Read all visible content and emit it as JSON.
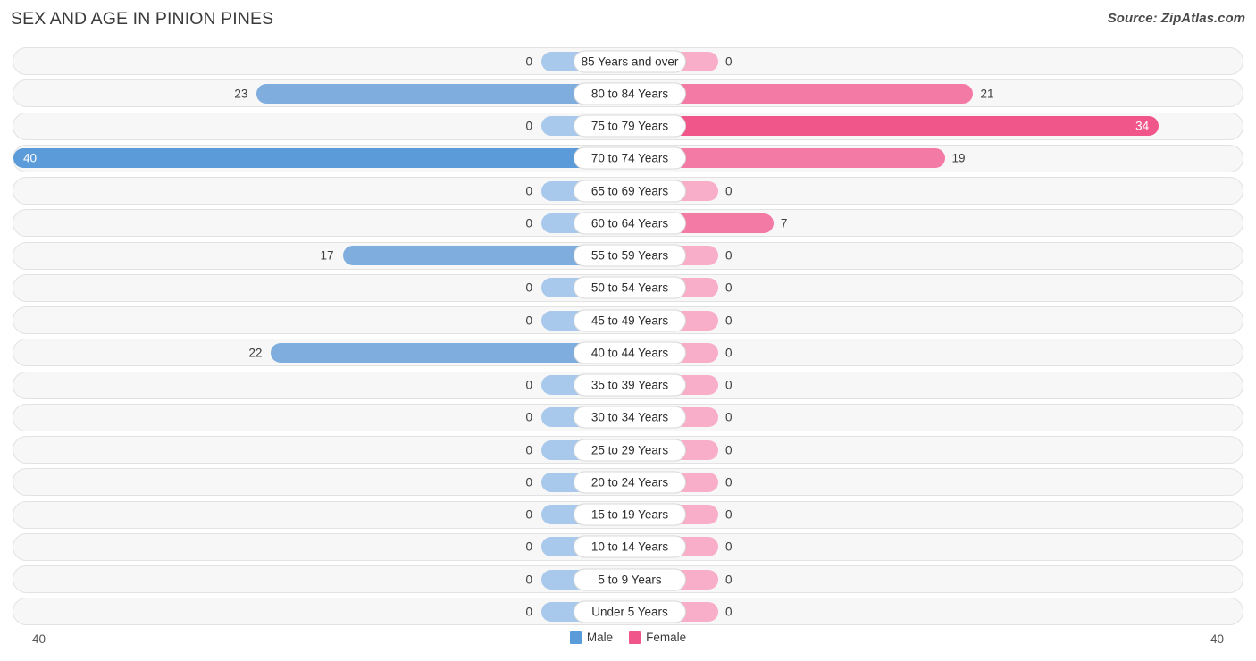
{
  "header": {
    "title": "SEX AND AGE IN PINION PINES",
    "source": "Source: ZipAtlas.com"
  },
  "legend": {
    "male_label": "Male",
    "female_label": "Female",
    "male_color": "#5b9bd9",
    "female_color": "#f05689"
  },
  "axis": {
    "left_label": "40",
    "right_label": "40",
    "max": 40
  },
  "chart_data": {
    "type": "bar",
    "subtype": "population-pyramid",
    "title": "SEX AND AGE IN PINION PINES",
    "xlabel": "",
    "ylabel": "",
    "grid": false,
    "legend_position": "bottom-center",
    "axis_max": 40,
    "xlim": [
      40,
      40
    ],
    "categories": [
      "85 Years and over",
      "80 to 84 Years",
      "75 to 79 Years",
      "70 to 74 Years",
      "65 to 69 Years",
      "60 to 64 Years",
      "55 to 59 Years",
      "50 to 54 Years",
      "45 to 49 Years",
      "40 to 44 Years",
      "35 to 39 Years",
      "30 to 34 Years",
      "25 to 29 Years",
      "20 to 24 Years",
      "15 to 19 Years",
      "10 to 14 Years",
      "5 to 9 Years",
      "Under 5 Years"
    ],
    "series": [
      {
        "name": "Male",
        "color": "#5b9bd9",
        "values": [
          0,
          23,
          0,
          40,
          0,
          0,
          17,
          0,
          0,
          22,
          0,
          0,
          0,
          0,
          0,
          0,
          0,
          0
        ]
      },
      {
        "name": "Female",
        "color": "#f05689",
        "values": [
          0,
          21,
          34,
          19,
          0,
          7,
          0,
          0,
          0,
          0,
          0,
          0,
          0,
          0,
          0,
          0,
          0,
          0
        ]
      }
    ]
  },
  "rows": [
    {
      "label": "85 Years and over",
      "male": 0,
      "male_text": "0",
      "female": 0,
      "female_text": "0"
    },
    {
      "label": "80 to 84 Years",
      "male": 23,
      "male_text": "23",
      "female": 21,
      "female_text": "21"
    },
    {
      "label": "75 to 79 Years",
      "male": 0,
      "male_text": "0",
      "female": 34,
      "female_text": "34"
    },
    {
      "label": "70 to 74 Years",
      "male": 40,
      "male_text": "40",
      "female": 19,
      "female_text": "19"
    },
    {
      "label": "65 to 69 Years",
      "male": 0,
      "male_text": "0",
      "female": 0,
      "female_text": "0"
    },
    {
      "label": "60 to 64 Years",
      "male": 0,
      "male_text": "0",
      "female": 7,
      "female_text": "7"
    },
    {
      "label": "55 to 59 Years",
      "male": 17,
      "male_text": "17",
      "female": 0,
      "female_text": "0"
    },
    {
      "label": "50 to 54 Years",
      "male": 0,
      "male_text": "0",
      "female": 0,
      "female_text": "0"
    },
    {
      "label": "45 to 49 Years",
      "male": 0,
      "male_text": "0",
      "female": 0,
      "female_text": "0"
    },
    {
      "label": "40 to 44 Years",
      "male": 22,
      "male_text": "22",
      "female": 0,
      "female_text": "0"
    },
    {
      "label": "35 to 39 Years",
      "male": 0,
      "male_text": "0",
      "female": 0,
      "female_text": "0"
    },
    {
      "label": "30 to 34 Years",
      "male": 0,
      "male_text": "0",
      "female": 0,
      "female_text": "0"
    },
    {
      "label": "25 to 29 Years",
      "male": 0,
      "male_text": "0",
      "female": 0,
      "female_text": "0"
    },
    {
      "label": "20 to 24 Years",
      "male": 0,
      "male_text": "0",
      "female": 0,
      "female_text": "0"
    },
    {
      "label": "15 to 19 Years",
      "male": 0,
      "male_text": "0",
      "female": 0,
      "female_text": "0"
    },
    {
      "label": "10 to 14 Years",
      "male": 0,
      "male_text": "0",
      "female": 0,
      "female_text": "0"
    },
    {
      "label": "5 to 9 Years",
      "male": 0,
      "male_text": "0",
      "female": 0,
      "female_text": "0"
    },
    {
      "label": "Under 5 Years",
      "male": 0,
      "male_text": "0",
      "female": 0,
      "female_text": "0"
    }
  ]
}
